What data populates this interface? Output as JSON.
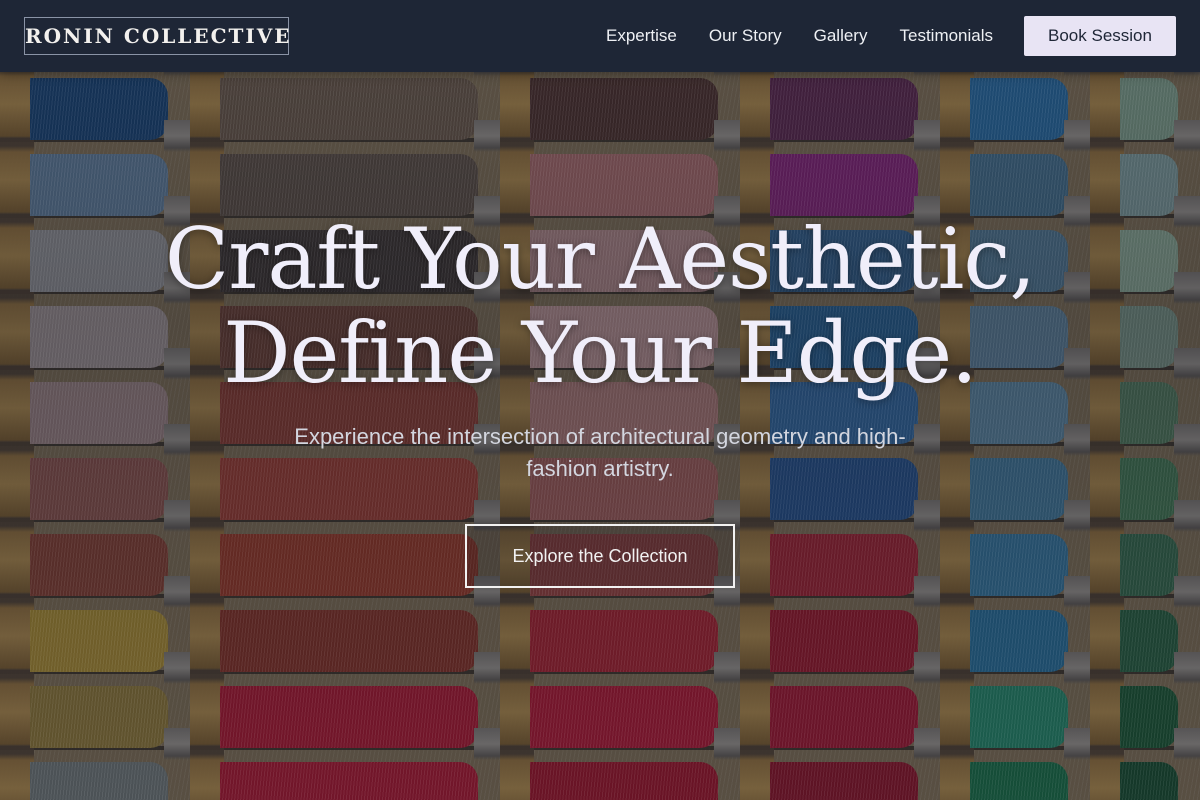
{
  "header": {
    "logo": "RONIN COLLECTIVE",
    "nav": [
      "Expertise",
      "Our Story",
      "Gallery",
      "Testimonials"
    ],
    "cta_label": "Book Session"
  },
  "hero": {
    "headline_line1": "Craft Your Aesthetic,",
    "headline_line2": "Define Your Edge.",
    "subtitle": "Experience the intersection of architectural geometry and high-fashion artistry.",
    "cta_label": "Explore the Collection",
    "background_icon": "thread-spools-image"
  },
  "colors": {
    "nav_background": "#1e2636",
    "button_background": "#e8e4f4",
    "headline_text": "#f0eefa"
  }
}
